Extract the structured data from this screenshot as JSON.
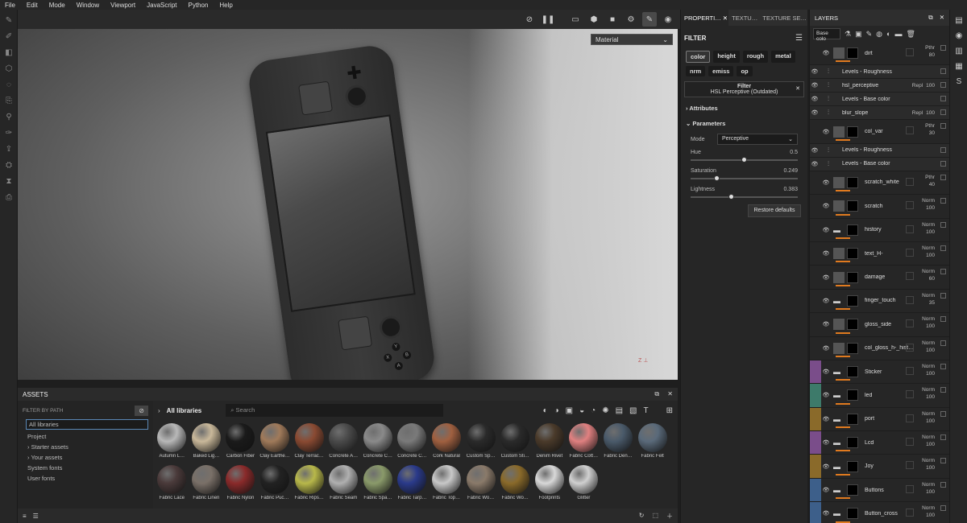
{
  "menu": [
    "File",
    "Edit",
    "Mode",
    "Window",
    "Viewport",
    "JavaScript",
    "Python",
    "Help"
  ],
  "viewport": {
    "material_select": "Material",
    "axis_label": "Z"
  },
  "properties": {
    "tabs": [
      "PROPERTI…",
      "TEXTU…",
      "TEXTURE SE…"
    ],
    "filter_title": "FILTER",
    "channels": [
      "color",
      "height",
      "rough",
      "metal",
      "nrm",
      "emiss",
      "op"
    ],
    "filter_box_title": "Filter",
    "filter_box_sub": "HSL Perceptive (Outdated)",
    "attributes": "Attributes",
    "parameters": "Parameters",
    "mode_label": "Mode",
    "mode_value": "Perceptive",
    "hue_label": "Hue",
    "hue_value": "0.5",
    "hue_level": 0.5,
    "sat_label": "Saturation",
    "sat_value": "0.249",
    "sat_level": 0.249,
    "light_label": "Lightness",
    "light_value": "0.383",
    "light_level": 0.383,
    "restore": "Restore defaults"
  },
  "layers": {
    "title": "LAYERS",
    "channel_select": "Base colo",
    "rows": [
      {
        "name": "dirt",
        "blend": "Pthr",
        "value": "80",
        "type": "fill",
        "strip": "",
        "sub": false
      },
      {
        "name": "Levels - Roughness",
        "type": "effect",
        "sub": true
      },
      {
        "name": "hsl_perceptive",
        "blend": "Repl",
        "value": "100",
        "type": "effect",
        "sub": true
      },
      {
        "name": "Levels - Base color",
        "type": "effect",
        "sub": true
      },
      {
        "name": "blur_slope",
        "blend": "Repl",
        "value": "100",
        "type": "effect",
        "sub": true
      },
      {
        "name": "col_var",
        "blend": "Pthr",
        "value": "30",
        "type": "fill",
        "strip": "",
        "sub": false
      },
      {
        "name": "Levels - Roughness",
        "type": "effect",
        "sub": true
      },
      {
        "name": "Levels - Base color",
        "type": "effect",
        "sub": true
      },
      {
        "name": "scratch_white",
        "blend": "Pthr",
        "value": "40",
        "type": "fill",
        "strip": "",
        "sub": false
      },
      {
        "name": "scratch",
        "blend": "Norm",
        "value": "100",
        "type": "fill",
        "strip": "",
        "sub": false
      },
      {
        "name": "history",
        "blend": "Norm",
        "value": "100",
        "type": "folder",
        "strip": "",
        "sub": false
      },
      {
        "name": "text_H-",
        "blend": "Norm",
        "value": "100",
        "type": "fill",
        "strip": "",
        "sub": false
      },
      {
        "name": "damage",
        "blend": "Norm",
        "value": "60",
        "type": "fill",
        "strip": "",
        "sub": false
      },
      {
        "name": "finger_touch",
        "blend": "Norm",
        "value": "35",
        "type": "folder",
        "strip": "",
        "sub": false
      },
      {
        "name": "gloss_side",
        "blend": "Norm",
        "value": "100",
        "type": "fill",
        "strip": "",
        "sub": false
      },
      {
        "name": "col_gloss_h-_hist…",
        "blend": "Norm",
        "value": "100",
        "type": "fill",
        "strip": "",
        "sub": false
      },
      {
        "name": "Sticker",
        "blend": "Norm",
        "value": "100",
        "type": "folder",
        "strip": "#7a4d8a",
        "sub": false
      },
      {
        "name": "led",
        "blend": "Norm",
        "value": "100",
        "type": "folder",
        "strip": "#3d7a6a",
        "sub": false
      },
      {
        "name": "port",
        "blend": "Norm",
        "value": "100",
        "type": "folder",
        "strip": "#8a6a2a",
        "sub": false
      },
      {
        "name": "Lcd",
        "blend": "Norm",
        "value": "100",
        "type": "folder",
        "strip": "#7a4d8a",
        "sub": false
      },
      {
        "name": "Joy",
        "blend": "Norm",
        "value": "100",
        "type": "folder",
        "strip": "#8a6a2a",
        "sub": false
      },
      {
        "name": "Buttons",
        "blend": "Norm",
        "value": "100",
        "type": "folder",
        "strip": "#3d5f8a",
        "sub": false
      },
      {
        "name": "Button_cross",
        "blend": "Norm",
        "value": "100",
        "type": "folder",
        "strip": "#3d5f8a",
        "sub": false
      }
    ]
  },
  "assets": {
    "title": "ASSETS",
    "filter_label": "FILTER BY PATH",
    "tree": [
      "All libraries",
      "Project",
      "Starter assets",
      "Your assets",
      "System fonts",
      "User fonts"
    ],
    "breadcrumb": "All libraries",
    "search_placeholder": "Search",
    "items": [
      {
        "label": "Autumn L…",
        "color": "#b8b8b8"
      },
      {
        "label": "Baked Lig…",
        "color": "#c9b89a"
      },
      {
        "label": "Carbon Fiber",
        "color": "#1a1a1a"
      },
      {
        "label": "Clay Earthe…",
        "color": "#a07a5a"
      },
      {
        "label": "Clay Terrac…",
        "color": "#8a4a32"
      },
      {
        "label": "Concrete A…",
        "color": "#4a4a4a"
      },
      {
        "label": "Concrete C…",
        "color": "#8a8a8a"
      },
      {
        "label": "Concrete C…",
        "color": "#7a7a7a"
      },
      {
        "label": "Cork Natural",
        "color": "#a06040"
      },
      {
        "label": "Custom Sp…",
        "color": "#2a2a2a"
      },
      {
        "label": "Custom Sti…",
        "color": "#2a2a2a"
      },
      {
        "label": "Denim Rivet",
        "color": "#4a3a2a"
      },
      {
        "label": "Fabric Cott…",
        "color": "#e08080"
      },
      {
        "label": "Fabric Den…",
        "color": "#4a5a6a"
      },
      {
        "label": "Fabric Felt",
        "color": "#5a6a7a"
      },
      {
        "label": "Fabric Lace",
        "color": "#4a3a3a"
      },
      {
        "label": "Fabric Linen",
        "color": "#7a7068"
      },
      {
        "label": "Fabric Nylon",
        "color": "#8a2a2a"
      },
      {
        "label": "Fabric Puc…",
        "color": "#222222"
      },
      {
        "label": "Fabric Rips…",
        "color": "#b8b84a"
      },
      {
        "label": "Fabric Seam",
        "color": "#b0b0b0"
      },
      {
        "label": "Fabric Spa…",
        "color": "#8a9a6a"
      },
      {
        "label": "Fabric Tarp…",
        "color": "#2a3a8a"
      },
      {
        "label": "Fabric Top…",
        "color": "#c8c8c8"
      },
      {
        "label": "Fabric Wo…",
        "color": "#8a7a6a"
      },
      {
        "label": "Fabric Wo…",
        "color": "#8a6a2a"
      },
      {
        "label": "Footprints",
        "color": "#d8d8d8"
      },
      {
        "label": "Glitter",
        "color": "#d0d0d0"
      }
    ]
  },
  "icons": {
    "eye": "eye-icon",
    "folder": "folder-icon",
    "close": "close-icon",
    "chevron": "chevron-down-icon"
  }
}
